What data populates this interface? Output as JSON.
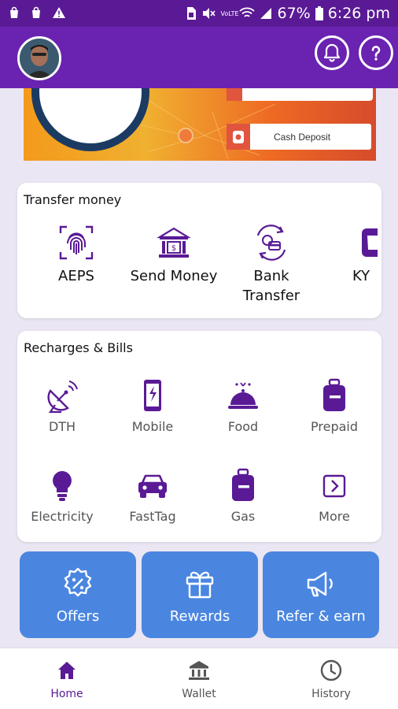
{
  "status_bar": {
    "battery": "67%",
    "time": "6:26 pm",
    "network": "VoLTE"
  },
  "banner": {
    "cash_deposit_label": "Cash Deposit"
  },
  "transfer": {
    "title": "Transfer money",
    "items": [
      {
        "label": "AEPS",
        "icon": "fingerprint-icon"
      },
      {
        "label": "Send Money",
        "icon": "bank-building-icon"
      },
      {
        "label": "Bank\nTransfer",
        "icon": "bank-transfer-icon"
      },
      {
        "label": "KY",
        "icon": "kyc-icon"
      }
    ]
  },
  "recharges": {
    "title": "Recharges & Bills",
    "items": [
      {
        "label": "DTH",
        "icon": "satellite-dish-icon"
      },
      {
        "label": "Mobile",
        "icon": "mobile-icon"
      },
      {
        "label": "Food",
        "icon": "food-cloche-icon"
      },
      {
        "label": "Prepaid",
        "icon": "prepaid-icon"
      },
      {
        "label": "Electricity",
        "icon": "bulb-icon"
      },
      {
        "label": "FastTag",
        "icon": "car-icon"
      },
      {
        "label": "Gas",
        "icon": "gas-cylinder-icon"
      },
      {
        "label": "More",
        "icon": "more-arrow-icon"
      }
    ]
  },
  "promos": [
    {
      "label": "Offers",
      "icon": "offer-badge-icon"
    },
    {
      "label": "Rewards",
      "icon": "gift-icon"
    },
    {
      "label": "Refer & earn",
      "icon": "megaphone-icon"
    }
  ],
  "bottom_nav": [
    {
      "label": "Home",
      "icon": "home-icon",
      "active": true
    },
    {
      "label": "Wallet",
      "icon": "wallet-bank-icon",
      "active": false
    },
    {
      "label": "History",
      "icon": "clock-icon",
      "active": false
    }
  ],
  "colors": {
    "primary": "#6a23b0",
    "status_bar": "#5a1a95",
    "icon_purple": "#5a1a95",
    "promo_blue": "#4a86e0",
    "background": "#ebe6f3"
  }
}
